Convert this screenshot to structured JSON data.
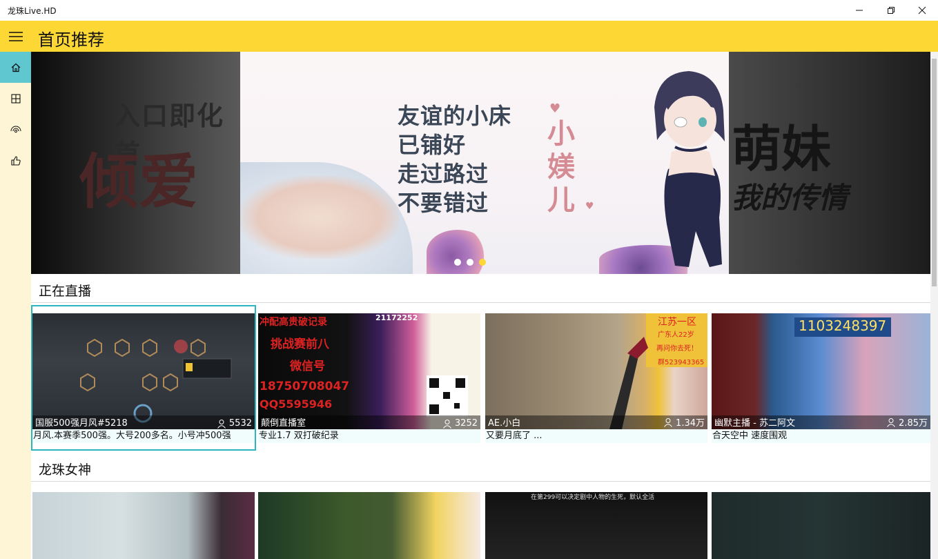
{
  "window": {
    "title": "龙珠Live.HD"
  },
  "header": {
    "title": "首页推荐"
  },
  "nav": {
    "items": [
      {
        "name": "home",
        "icon": "home-icon",
        "active": true
      },
      {
        "name": "categories",
        "icon": "grid-icon",
        "active": false
      },
      {
        "name": "live",
        "icon": "broadcast-icon",
        "active": false
      },
      {
        "name": "recommend",
        "icon": "thumbs-up-icon",
        "active": false
      }
    ]
  },
  "banner": {
    "left_text_1": "入口即化首",
    "left_text_2": "倾爱",
    "center_lines": [
      "友谊的小床",
      "已铺好",
      "走过路过",
      "不要错过"
    ],
    "center_vertical": "小媄儿",
    "right_text_1": "萌妹",
    "right_text_2": "我的传情",
    "slides": 3,
    "active_slide": 3
  },
  "sections": [
    {
      "title": "正在直播",
      "cards": [
        {
          "name": "国服500强月风#5218",
          "viewers": "5532",
          "desc": "月风.本赛季500强。大号200多名。小号冲500强",
          "selected": true
        },
        {
          "name": "颠倒直播室",
          "viewers": "3252",
          "desc": "专业1.7 双打破纪录",
          "overlay": [
            "挑战赛前八",
            "微信号",
            "18750708047",
            "QQ5595946"
          ],
          "overlay_top": "冲配高贵破记录",
          "overlay_num": "21172252"
        },
        {
          "name": "AE.小白",
          "viewers": "1.34万",
          "desc": "又要月底了 ...",
          "overlay": [
            "江苏一区",
            "广东人22岁",
            "再问你去死！",
            "群523943365"
          ]
        },
        {
          "name": "幽默主播 - 苏二阿文",
          "viewers": "2.85万",
          "desc": "合天空中 速度围观",
          "overlay_num": "1103248397"
        }
      ]
    },
    {
      "title": "龙珠女神",
      "cards": [
        {
          "name": "",
          "viewers": "",
          "desc": ""
        },
        {
          "name": "",
          "viewers": "",
          "desc": ""
        },
        {
          "name": "",
          "viewers": "",
          "desc": "",
          "overlay_top": "在第299可以决定剧中人物的生死，默认全活"
        },
        {
          "name": "",
          "viewers": "",
          "desc": ""
        }
      ]
    }
  ],
  "colors": {
    "accent": "#fdd835",
    "nav_active": "#5ec7cf",
    "selection": "#29b6c0",
    "sidebar": "#fdf5d6"
  }
}
